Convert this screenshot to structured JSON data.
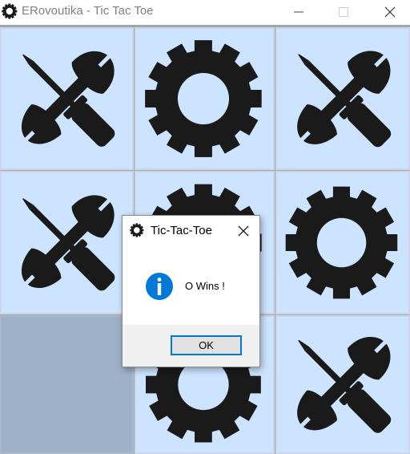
{
  "window": {
    "title": "ERovoutika - Tic Tac Toe",
    "icon": "gear-icon"
  },
  "board": {
    "cells": [
      {
        "position": 1,
        "mark": "X",
        "icon": "wrench-screwdriver-icon"
      },
      {
        "position": 2,
        "mark": "O",
        "icon": "gear-icon"
      },
      {
        "position": 3,
        "mark": "X",
        "icon": "wrench-screwdriver-icon"
      },
      {
        "position": 4,
        "mark": "X",
        "icon": "wrench-screwdriver-icon"
      },
      {
        "position": 5,
        "mark": "O",
        "icon": "gear-icon"
      },
      {
        "position": 6,
        "mark": "O",
        "icon": "gear-icon"
      },
      {
        "position": 7,
        "mark": "",
        "icon": ""
      },
      {
        "position": 8,
        "mark": "O",
        "icon": "gear-icon"
      },
      {
        "position": 9,
        "mark": "X",
        "icon": "wrench-screwdriver-icon"
      }
    ]
  },
  "dialog": {
    "title": "Tic-Tac-Toe",
    "message": "O Wins !",
    "ok_label": "OK",
    "icon": "info-icon"
  },
  "colors": {
    "cell_background": "#cce4ff",
    "empty_cell": "#9eb1c8",
    "board_grid": "#9fa7b4",
    "icon_fill": "#1a1a1a",
    "info_blue": "#0078d7"
  }
}
